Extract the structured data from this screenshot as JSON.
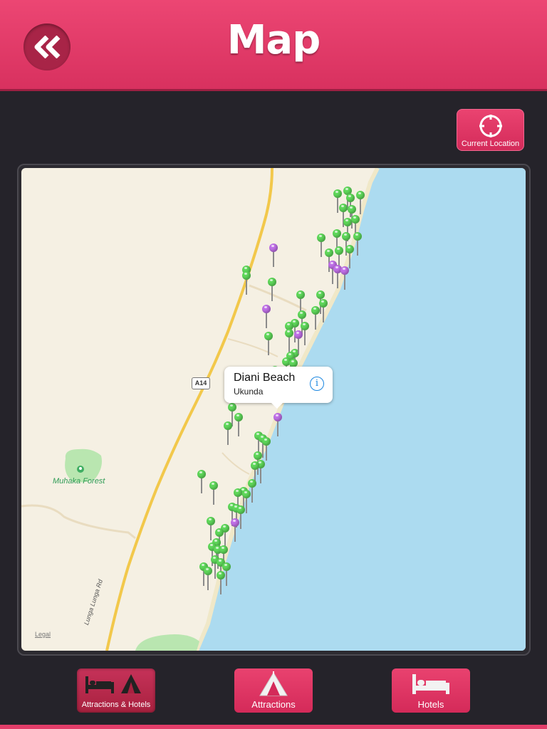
{
  "header": {
    "title": "Map",
    "back_icon": "double-chevron-left-icon",
    "color": "#e03a67"
  },
  "location_button": {
    "label": "Current Location",
    "icon": "crosshair-icon"
  },
  "map": {
    "callout": {
      "title": "Diani Beach",
      "subtitle": "Ukunda",
      "icon": "info-icon"
    },
    "road_shield": "A14",
    "forest_label": "Muhaka Forest",
    "road_label": "Lunga Lunga Rd",
    "legal": "Legal",
    "pin_colors": {
      "hotel": "#5fd85a",
      "attraction": "#c070e8"
    }
  },
  "tabs": [
    {
      "label": "Attractions & Hotels",
      "icon": "bed-and-tent-icon",
      "active": true
    },
    {
      "label": "Attractions",
      "icon": "tent-icon",
      "active": false
    },
    {
      "label": "Hotels",
      "icon": "bed-icon",
      "active": false
    }
  ]
}
